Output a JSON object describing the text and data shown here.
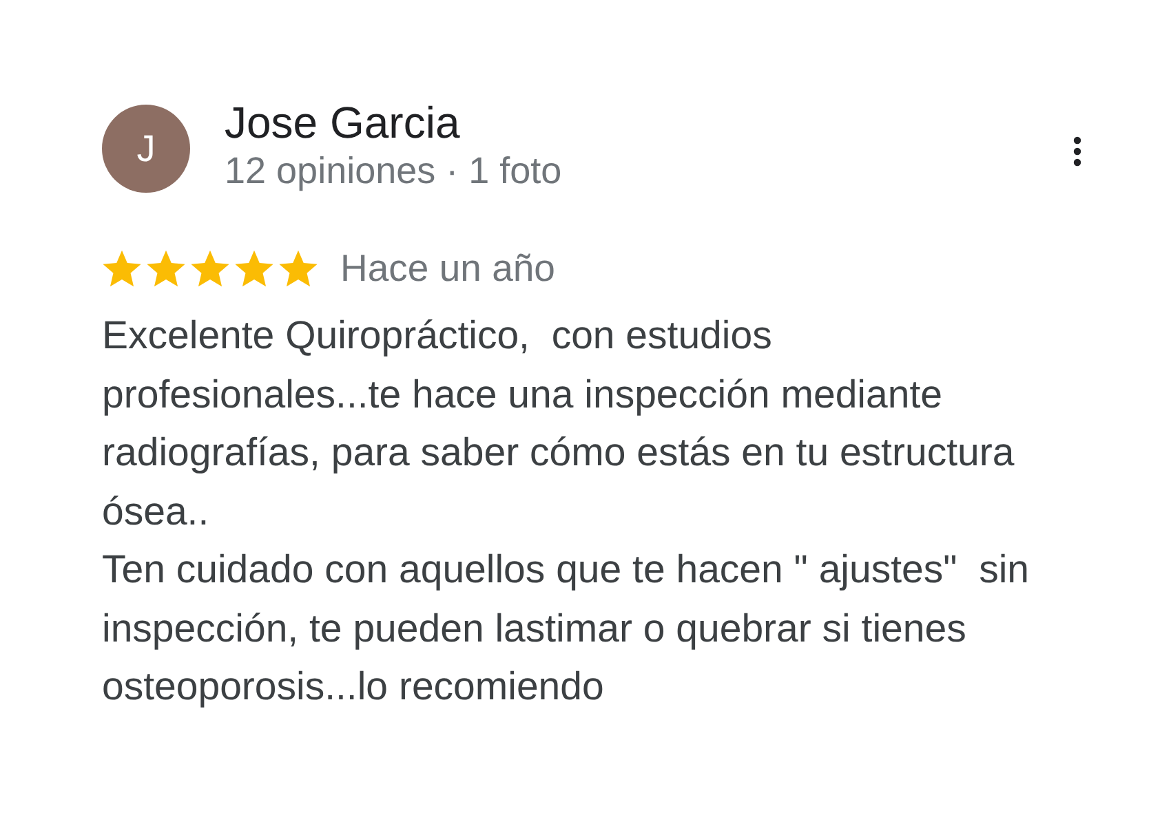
{
  "review": {
    "author": {
      "initial": "J",
      "name": "Jose Garcia",
      "meta": "12 opiniones · 1 foto"
    },
    "stars": 5,
    "date": "Hace un año",
    "paragraphs": [
      "Excelente Quiropráctico,  con estudios profesionales...te hace una inspección mediante radiografías, para saber cómo estás en tu estructura ósea..",
      "Ten cuidado con aquellos que te hacen \" ajustes\"  sin inspección, te pueden lastimar o quebrar si tienes osteoporosis...lo recomiendo"
    ]
  }
}
